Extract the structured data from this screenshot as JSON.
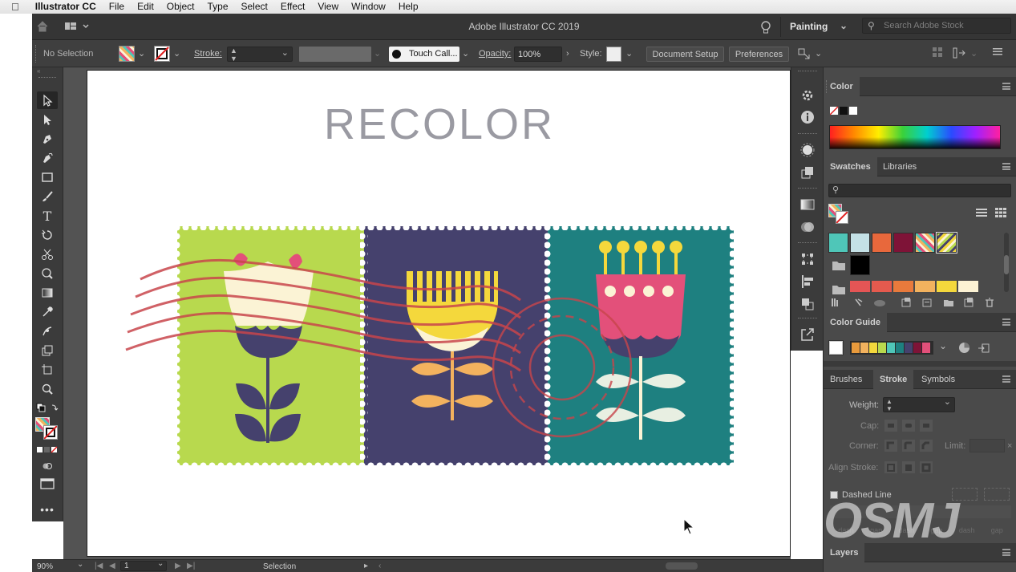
{
  "menubar": {
    "app": "Illustrator CC",
    "items": [
      "File",
      "Edit",
      "Object",
      "Type",
      "Select",
      "Effect",
      "View",
      "Window",
      "Help"
    ]
  },
  "titlebar": {
    "title": "Adobe Illustrator CC 2019",
    "workspace": "Painting",
    "search_placeholder": "Search Adobe Stock"
  },
  "control": {
    "selection": "No Selection",
    "stroke_label": "Stroke:",
    "brush": "Touch Call...",
    "opacity_label": "Opacity:",
    "opacity_value": "100%",
    "style_label": "Style:",
    "doc_setup": "Document Setup",
    "preferences": "Preferences"
  },
  "artboard": {
    "heading": "RECOLOR"
  },
  "panels": {
    "color": {
      "title": "Color"
    },
    "swatches": {
      "tab1": "Swatches",
      "tab2": "Libraries"
    },
    "color_guide": {
      "title": "Color Guide"
    },
    "stroke": {
      "tabs": [
        "Brushes",
        "Stroke",
        "Symbols"
      ],
      "weight_label": "Weight:",
      "cap_label": "Cap:",
      "corner_label": "Corner:",
      "limit_label": "Limit:",
      "align_label": "Align Stroke:",
      "dashed_label": "Dashed Line",
      "dash_labels": [
        "dash",
        "gap",
        "dash",
        "gap",
        "dash",
        "gap"
      ]
    },
    "layers": {
      "title": "Layers"
    }
  },
  "status": {
    "zoom": "90%",
    "page": "1",
    "mode": "Selection"
  },
  "watermark": "OSMJ",
  "colors": {
    "ui_dark": "#3b3b3b",
    "lime": "#b8d94e",
    "indigo": "#45416d",
    "teal": "#1e8080",
    "pink": "#e3507a",
    "yellow": "#f4d83c",
    "cream": "#fbf3d5",
    "orange": "#f3b25e",
    "postmark": "#c8454b"
  },
  "swatch_colors": {
    "row1": [
      "#4fc6b8",
      "#c4e1e6",
      "#e8683c",
      "#7e1337"
    ],
    "row3": [
      "#e55555",
      "#e55a4e",
      "#e87a3c",
      "#f2b25e",
      "#f4d83c",
      "#fcf2d4"
    ],
    "guide": [
      "#e89a3c",
      "#f2b25e",
      "#f4d83c",
      "#b8d94e",
      "#4fc6b8",
      "#1e8080",
      "#45416d",
      "#7e1337",
      "#e3507a"
    ]
  }
}
